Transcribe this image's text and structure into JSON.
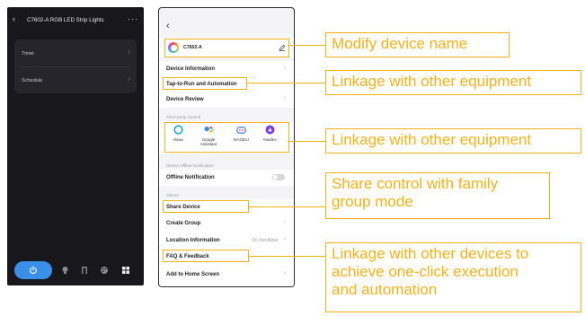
{
  "left_phone": {
    "title": "C7602-A RGB LED Strip Lights",
    "back_icon": "‹",
    "more_icon": "···",
    "rows": [
      {
        "label": "Timer"
      },
      {
        "label": "Schedule"
      }
    ],
    "bottom_bar": {
      "power_icon": "power-icon",
      "icons": [
        "bulb-icon",
        "music-icon",
        "palette-icon",
        "grid-icon"
      ],
      "accent": "#3a8fe8"
    }
  },
  "right_phone": {
    "back_icon": "‹",
    "device_name": "C7602-A",
    "rows": {
      "device_information": "Device Information",
      "tap_to_run": "Tap-to-Run and Automation",
      "device_review": "Device Review",
      "offline_notification": "Offline Notification",
      "share_device": "Share Device",
      "create_group": "Create Group",
      "location_information": "Location Information",
      "location_value": "Do Not Allow",
      "faq": "FAQ & Feedback",
      "add_home": "Add to Home Screen"
    },
    "sections": {
      "third_party": "Third-party Control",
      "offline": "Device Offline Notification",
      "others": "Others"
    },
    "third_party_items": [
      {
        "label": "Alexa",
        "icon": "alexa-icon"
      },
      {
        "label": "Google Assistant",
        "icon": "google-assistant-icon"
      },
      {
        "label": "XIAODU",
        "icon": "xiaodu-icon"
      },
      {
        "label": "Yandex",
        "icon": "yandex-icon"
      }
    ]
  },
  "callouts": {
    "modify_name": "Modify device name",
    "linkage_1": "Linkage with other equipment",
    "linkage_2": "Linkage with other equipment",
    "share_line1": "Share control with family",
    "share_line2": "group mode",
    "oneclick_line1": "Linkage with other devices to",
    "oneclick_line2": "achieve one-click execution",
    "oneclick_line3": "and automation"
  },
  "colors": {
    "highlight": "#f2b21b",
    "dark_bg": "#17171c",
    "light_bg": "#f4f4f6"
  }
}
